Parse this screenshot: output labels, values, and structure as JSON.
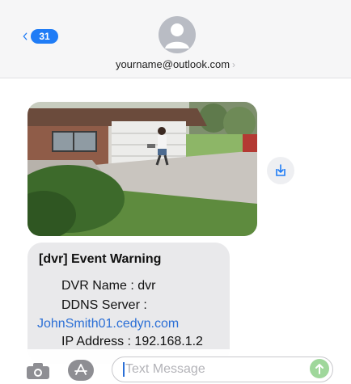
{
  "header": {
    "unread_count": "31",
    "contact_name": "yourname@outlook.com",
    "contact_chevron": "›"
  },
  "message": {
    "title": "[dvr] Event Warning",
    "lines": [
      "DVR Name : dvr",
      "DDNS Server :",
      "JohnSmith01.cedyn.com",
      "IP Address : 192.168.1.2"
    ]
  },
  "composer": {
    "placeholder": "Text Message"
  },
  "icons": {
    "back": "chevron-left-icon",
    "avatar": "person-icon",
    "download": "download-icon",
    "camera": "camera-icon",
    "apps": "app-store-icon",
    "send": "send-arrow-icon"
  },
  "colors": {
    "accent": "#1f7cf6",
    "bubble": "#e9e9eb",
    "link": "#2b6fd6",
    "send": "#9fd79b"
  }
}
